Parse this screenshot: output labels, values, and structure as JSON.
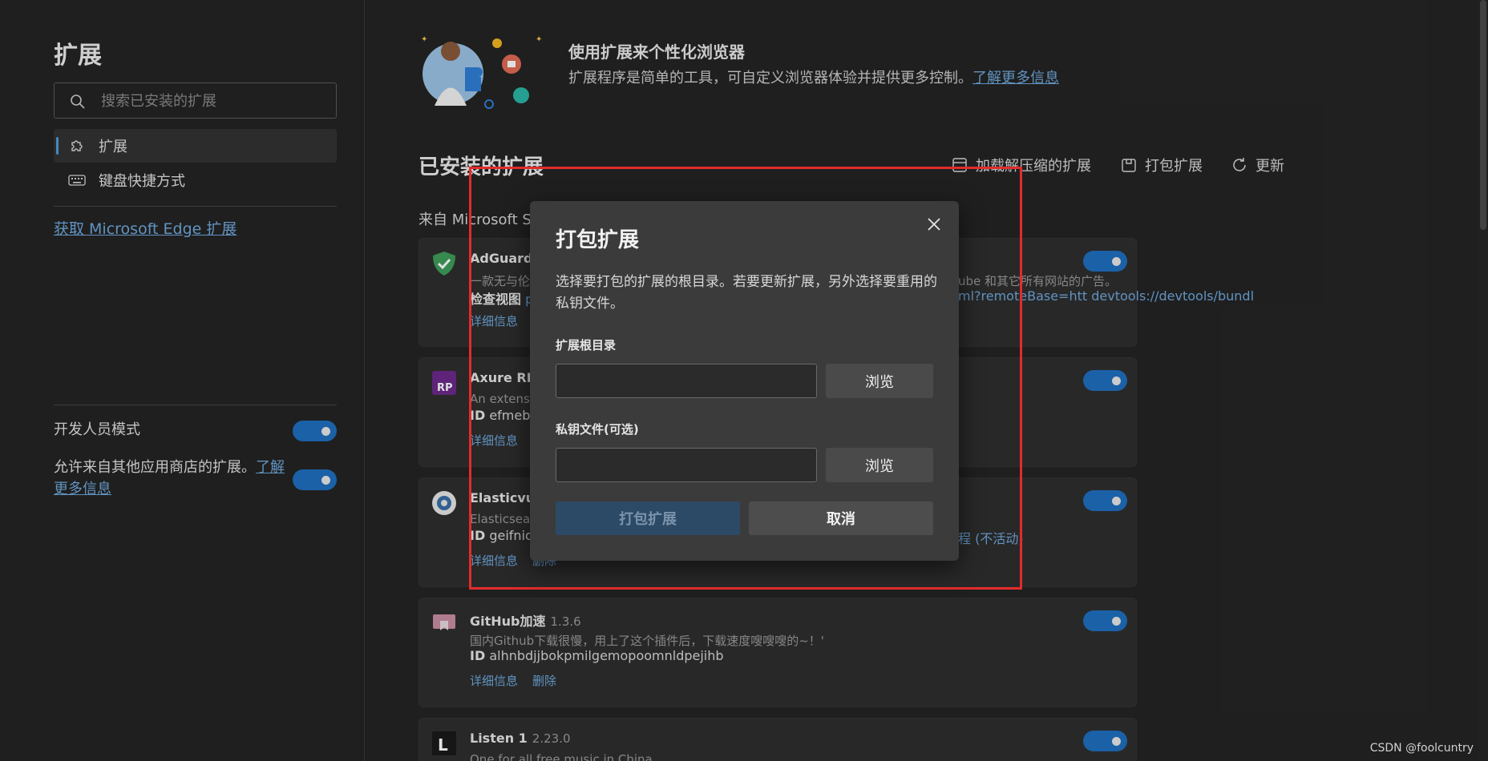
{
  "sidebar": {
    "title": "扩展",
    "search_placeholder": "搜索已安装的扩展",
    "nav": [
      {
        "label": "扩展",
        "icon": "puzzle-icon"
      },
      {
        "label": "键盘快捷方式",
        "icon": "keyboard-icon"
      }
    ],
    "get_extensions_link": "获取 Microsoft Edge 扩展",
    "dev_mode_label": "开发人员模式",
    "dev_mode_on": true,
    "allow_other_stores_label": "允许来自其他应用商店的扩展。",
    "allow_other_stores_link": "了解更多信息",
    "allow_other_stores_on": true
  },
  "hero": {
    "title": "使用扩展来个性化浏览器",
    "desc": "扩展程序是简单的工具，可自定义浏览器体验并提供更多控制。",
    "link": "了解更多信息"
  },
  "installed": {
    "title": "已安装的扩展",
    "actions": {
      "load_unpacked": "加载解压缩的扩展",
      "pack": "打包扩展",
      "update": "更新"
    },
    "source_heading": "来自 Microsoft S",
    "cards": [
      {
        "name": "AdGuard",
        "version": "",
        "desc": "一款无与伦",
        "id_label": "检查视图",
        "id_value": "p",
        "links": [
          "详细信息"
        ],
        "right_desc": "ube 和其它所有网站的广告。",
        "right_id": "ml?remoteBase=htt devtools://devtools/bundl",
        "enabled": true
      },
      {
        "name": "Axure RP",
        "version": "",
        "desc": "An extens",
        "id_label": "ID",
        "id_value": "efmeba",
        "links": [
          "详细信息"
        ],
        "right_desc": "",
        "right_id": "",
        "enabled": true
      },
      {
        "name": "Elasticvue",
        "version": "",
        "desc": "Elasticsear",
        "id_label": "ID",
        "id_value": "geifnio",
        "links": [
          "详细信息",
          "删除"
        ],
        "right_desc": "",
        "right_id": "程 (不活动)",
        "enabled": true
      },
      {
        "name": "GitHub加速",
        "version": "1.3.6",
        "desc": "国内Github下载很慢，用上了这个插件后，下载速度嗖嗖嗖的~！'",
        "id_label": "ID",
        "id_value": "alhnbdjjbokpmilgemopoomnldpejihb",
        "links": [
          "详细信息",
          "删除"
        ],
        "right_desc": "",
        "right_id": "",
        "enabled": true
      },
      {
        "name": "Listen 1",
        "version": "2.23.0",
        "desc": "One for all free music in China",
        "id_label": "",
        "id_value": "",
        "links": [],
        "right_desc": "",
        "right_id": "",
        "enabled": true
      }
    ]
  },
  "dialog": {
    "title": "打包扩展",
    "desc": "选择要打包的扩展的根目录。若要更新扩展，另外选择要重用的私钥文件。",
    "root_label": "扩展根目录",
    "root_value": "",
    "key_label": "私钥文件(可选)",
    "key_value": "",
    "browse_label": "浏览",
    "pack_label": "打包扩展",
    "cancel_label": "取消"
  },
  "watermark": "CSDN @foolcuntry",
  "colors": {
    "accent": "#1f6fbf",
    "link": "#6fa8dc",
    "highlight_box": "#e32b2b"
  }
}
